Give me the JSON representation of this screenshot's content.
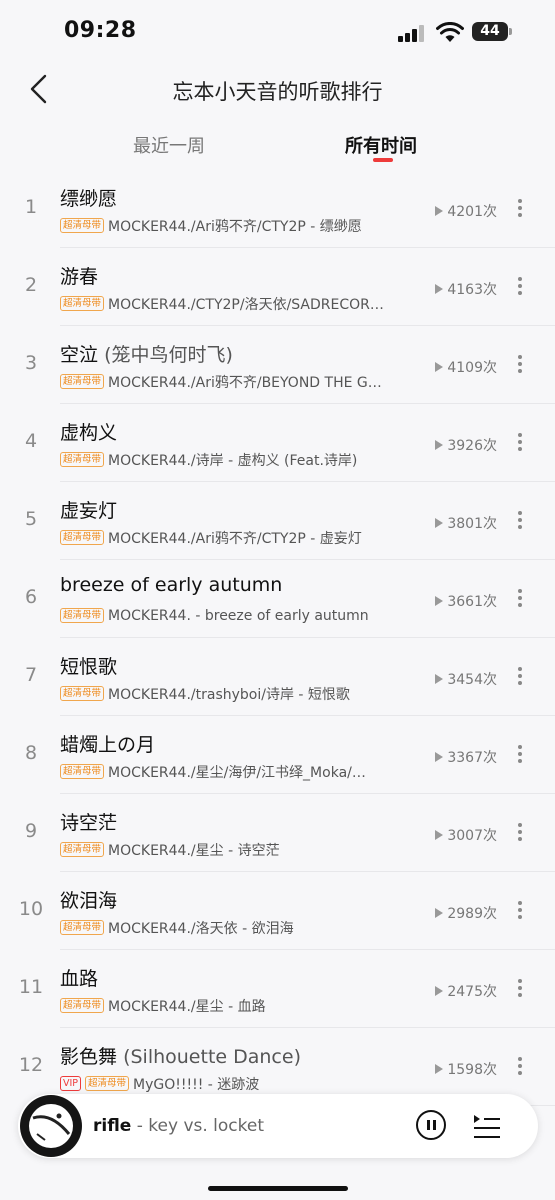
{
  "status_bar": {
    "time": "09:28",
    "battery": "44"
  },
  "header": {
    "title": "忘本小天音的听歌排行"
  },
  "tabs": [
    {
      "label": "最近一周",
      "selected": false
    },
    {
      "label": "所有时间",
      "selected": true
    }
  ],
  "songs": [
    {
      "rank": "1",
      "title": "缥缈愿",
      "subtitle": "",
      "badges": [
        "超清母带"
      ],
      "artist": "MOCKER44./Ari鸦不齐/CTY2P - 缥缈愿",
      "plays": "4201次"
    },
    {
      "rank": "2",
      "title": "游春",
      "subtitle": "",
      "badges": [
        "超清母带"
      ],
      "artist": "MOCKER44./CTY2P/洛天依/SADRECOR…",
      "plays": "4163次"
    },
    {
      "rank": "3",
      "title": "空泣",
      "subtitle": "(笼中鸟何时飞)",
      "badges": [
        "超清母带"
      ],
      "artist": "MOCKER44./Ari鸦不齐/BEYOND THE G…",
      "plays": "4109次"
    },
    {
      "rank": "4",
      "title": "虚构义",
      "subtitle": "",
      "badges": [
        "超清母带"
      ],
      "artist": "MOCKER44./诗岸 - 虚构义 (Feat.诗岸)",
      "plays": "3926次"
    },
    {
      "rank": "5",
      "title": "虚妄灯",
      "subtitle": "",
      "badges": [
        "超清母带"
      ],
      "artist": "MOCKER44./Ari鸦不齐/CTY2P - 虚妄灯",
      "plays": "3801次"
    },
    {
      "rank": "6",
      "title": "breeze of early autumn",
      "subtitle": "",
      "badges": [
        "超清母带"
      ],
      "artist": "MOCKER44. - breeze of early autumn",
      "plays": "3661次"
    },
    {
      "rank": "7",
      "title": "短恨歌",
      "subtitle": "",
      "badges": [
        "超清母带"
      ],
      "artist": "MOCKER44./trashyboi/诗岸 - 短恨歌",
      "plays": "3454次"
    },
    {
      "rank": "8",
      "title": "蜡燭上の月",
      "subtitle": "",
      "badges": [
        "超清母带"
      ],
      "artist": "MOCKER44./星尘/海伊/江书绎_Moka/…",
      "plays": "3367次"
    },
    {
      "rank": "9",
      "title": "诗空茫",
      "subtitle": "",
      "badges": [
        "超清母带"
      ],
      "artist": "MOCKER44./星尘 - 诗空茫",
      "plays": "3007次"
    },
    {
      "rank": "10",
      "title": "欲泪海",
      "subtitle": "",
      "badges": [
        "超清母带"
      ],
      "artist": "MOCKER44./洛天依 - 欲泪海",
      "plays": "2989次"
    },
    {
      "rank": "11",
      "title": "血路",
      "subtitle": "",
      "badges": [
        "超清母带"
      ],
      "artist": "MOCKER44./星尘 - 血路",
      "plays": "2475次"
    },
    {
      "rank": "12",
      "title": "影色舞",
      "subtitle": "(Silhouette Dance)",
      "badges": [
        "VIP",
        "超清母带"
      ],
      "artist": "MyGO!!!!! - 迷跡波",
      "plays": "1598次"
    }
  ],
  "player": {
    "title": "rifle",
    "separator": " - ",
    "artist": "key vs. locket"
  },
  "colors": {
    "accent": "#ee3b3b",
    "badge": "#ee8a1c",
    "background": "#f7f7f9"
  }
}
